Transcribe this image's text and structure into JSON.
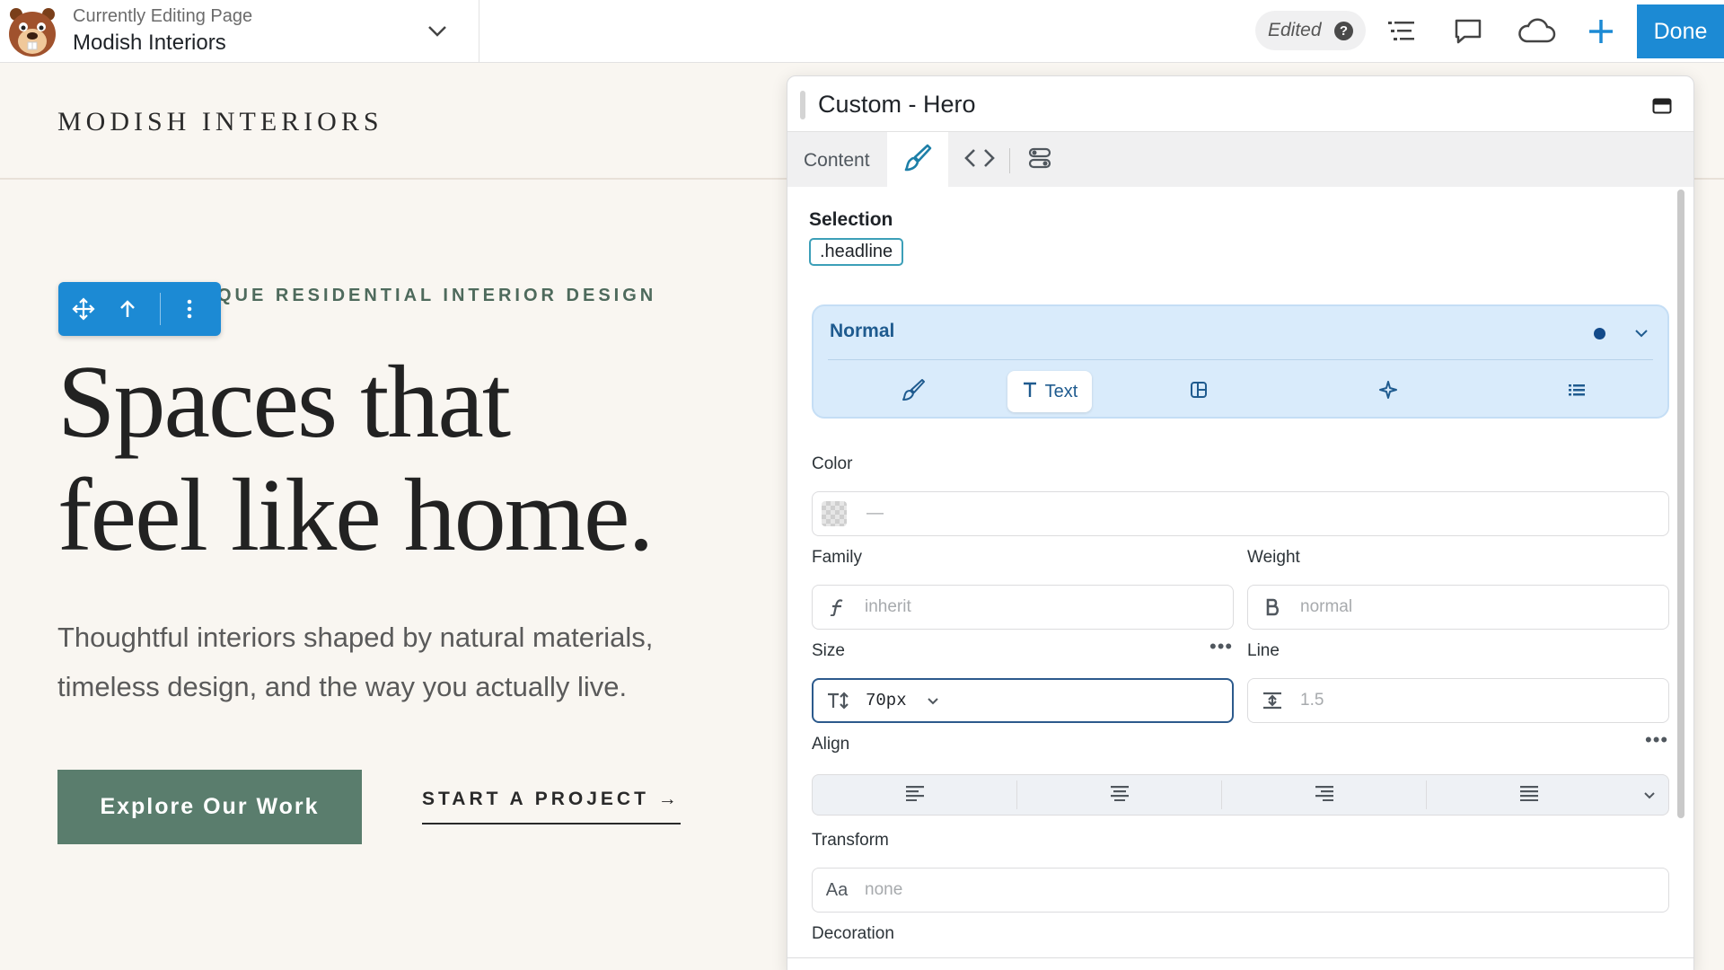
{
  "editor": {
    "caption": "Currently Editing Page",
    "page_name": "Modish Interiors",
    "status": "Edited",
    "help": "?",
    "done_label": "Done",
    "accent": "#1c8ad4"
  },
  "site": {
    "logo_text": "MODISH INTERIORS",
    "eyebrow": "QUE RESIDENTIAL INTERIOR DESIGN",
    "headline_line1": "Spaces that",
    "headline_line2": "feel like home.",
    "subtext": "Thoughtful interiors shaped by natural materials, timeless design, and the way you actually live.",
    "primary_button": "Explore Our Work",
    "secondary_link": "START A PROJECT →",
    "button_color": "#5a7d6d"
  },
  "panel": {
    "title": "Custom - Hero",
    "tabs": {
      "content": "Content"
    },
    "selection_label": "Selection",
    "selection_value": ".headline",
    "state": "Normal",
    "state_tabs": {
      "text": "Text"
    },
    "color": {
      "label": "Color",
      "value": "—"
    },
    "family": {
      "label": "Family",
      "placeholder": "inherit"
    },
    "weight": {
      "label": "Weight",
      "placeholder": "normal"
    },
    "size": {
      "label": "Size",
      "value": "70px"
    },
    "line": {
      "label": "Line",
      "placeholder": "1.5"
    },
    "align": {
      "label": "Align"
    },
    "transform": {
      "label": "Transform",
      "icon_text": "Aa",
      "placeholder": "none"
    },
    "decoration": {
      "label": "Decoration"
    }
  }
}
